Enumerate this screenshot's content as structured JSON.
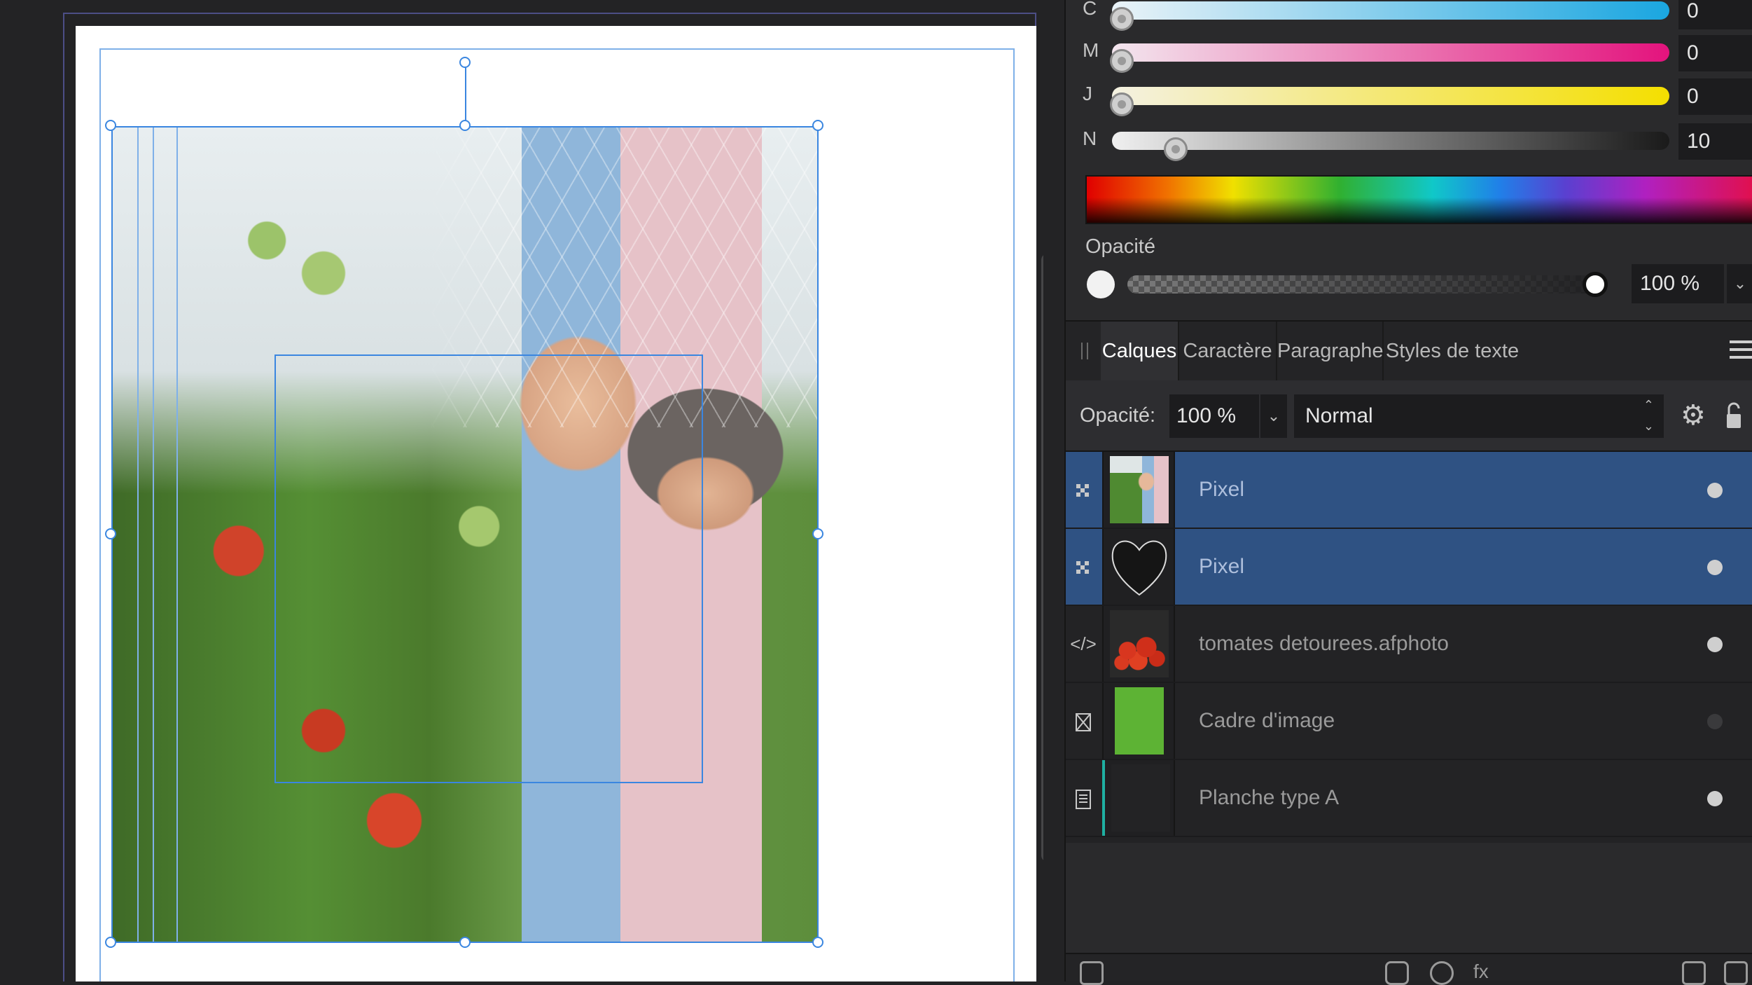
{
  "color": {
    "channels": [
      {
        "label": "C",
        "value": "0",
        "level": 0
      },
      {
        "label": "M",
        "value": "0",
        "level": 0
      },
      {
        "label": "J",
        "value": "0",
        "level": 0
      },
      {
        "label": "N",
        "value": "10",
        "level": 10
      }
    ],
    "opacity_label": "Opacité",
    "opacity_value": "100 %",
    "opacity_level": 100
  },
  "tabs": [
    "Calques",
    "Caractère",
    "Paragraphe",
    "Styles de texte"
  ],
  "active_tab": "Calques",
  "layer_options": {
    "opacity_label": "Opacité:",
    "opacity_value": "100 %",
    "blend_mode": "Normal"
  },
  "layers": [
    {
      "name": "Pixel",
      "type_icon": "pixel-icon",
      "thumbnail": "couple-photo",
      "selected": true,
      "visible": true
    },
    {
      "name": "Pixel",
      "type_icon": "pixel-icon",
      "thumbnail": "heart-shape",
      "selected": true,
      "visible": true
    },
    {
      "name": "tomates detourees.afphoto",
      "type_icon": "embedded-document-icon",
      "thumbnail": "tomatoes",
      "selected": false,
      "visible": true
    },
    {
      "name": "Cadre d'image",
      "type_icon": "picture-frame-icon",
      "thumbnail": "green-fill",
      "selected": false,
      "visible": false
    },
    {
      "name": "Planche type A",
      "type_icon": "master-page-icon",
      "thumbnail": "blank",
      "selected": false,
      "visible": true
    }
  ],
  "colors": {
    "selection_blue": "#3a86e0",
    "layer_selected": "#2f5283",
    "frame_green": "#5db334",
    "panel_bg": "#2a2a2c"
  }
}
